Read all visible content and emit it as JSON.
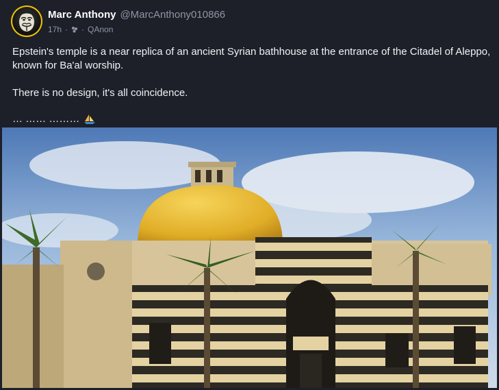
{
  "post": {
    "author": {
      "display_name": "Marc Anthony",
      "handle": "@MarcAnthony010866"
    },
    "meta": {
      "time": "17h",
      "sep1": "·",
      "sep2": "·",
      "community": "QAnon"
    },
    "text": {
      "paragraph1": "Epstein's temple is a near replica of an ancient Syrian bathhouse at the entrance of the Citadel of Aleppo, known for Ba'al worship.",
      "paragraph2": "There is no design, it's all coincidence.",
      "paragraph3": "… …… ………"
    },
    "icons": {
      "avatar": "guy-fawkes-mask-icon",
      "community": "community-icon",
      "emoji": "sailboat-icon"
    },
    "colors": {
      "background": "#1d2029",
      "avatar_ring": "#f0c400",
      "muted_text": "#8f95a3"
    }
  }
}
